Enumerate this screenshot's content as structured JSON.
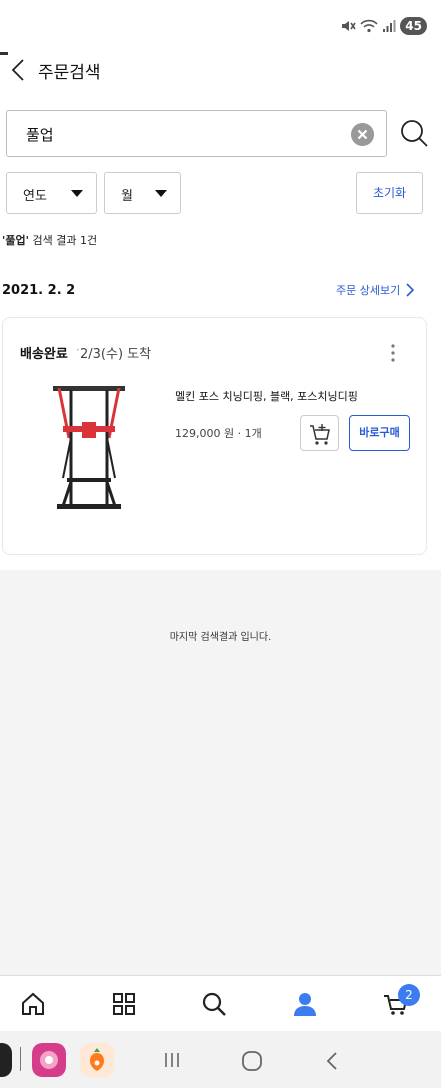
{
  "status_bar": {
    "battery": "45"
  },
  "header": {
    "title": "주문검색"
  },
  "search": {
    "query": "풀업"
  },
  "filters": {
    "year_label": "연도",
    "month_label": "월",
    "reset_label": "초기화"
  },
  "result_summary": {
    "keyword": "'풀업'",
    "text": " 검색 결과 1건"
  },
  "order": {
    "date": "2021. 2. 2",
    "detail_link": "주문 상세보기",
    "delivery_status": "배송완료",
    "delivery_separator": "·",
    "arrival": "2/3(수) 도착",
    "product_name": "멜킨 포스 치닝디핑, 블랙, 포스치닝디핑",
    "price_qty": "129,000 원 · 1개",
    "buy_now_label": "바로구매"
  },
  "end_message": "마지막 검색결과 입니다.",
  "bottom_nav": {
    "cart_count": "2"
  },
  "colors": {
    "accent": "#2a5bd7",
    "nav_active": "#3b7cf0",
    "product_red": "#d9343a"
  }
}
